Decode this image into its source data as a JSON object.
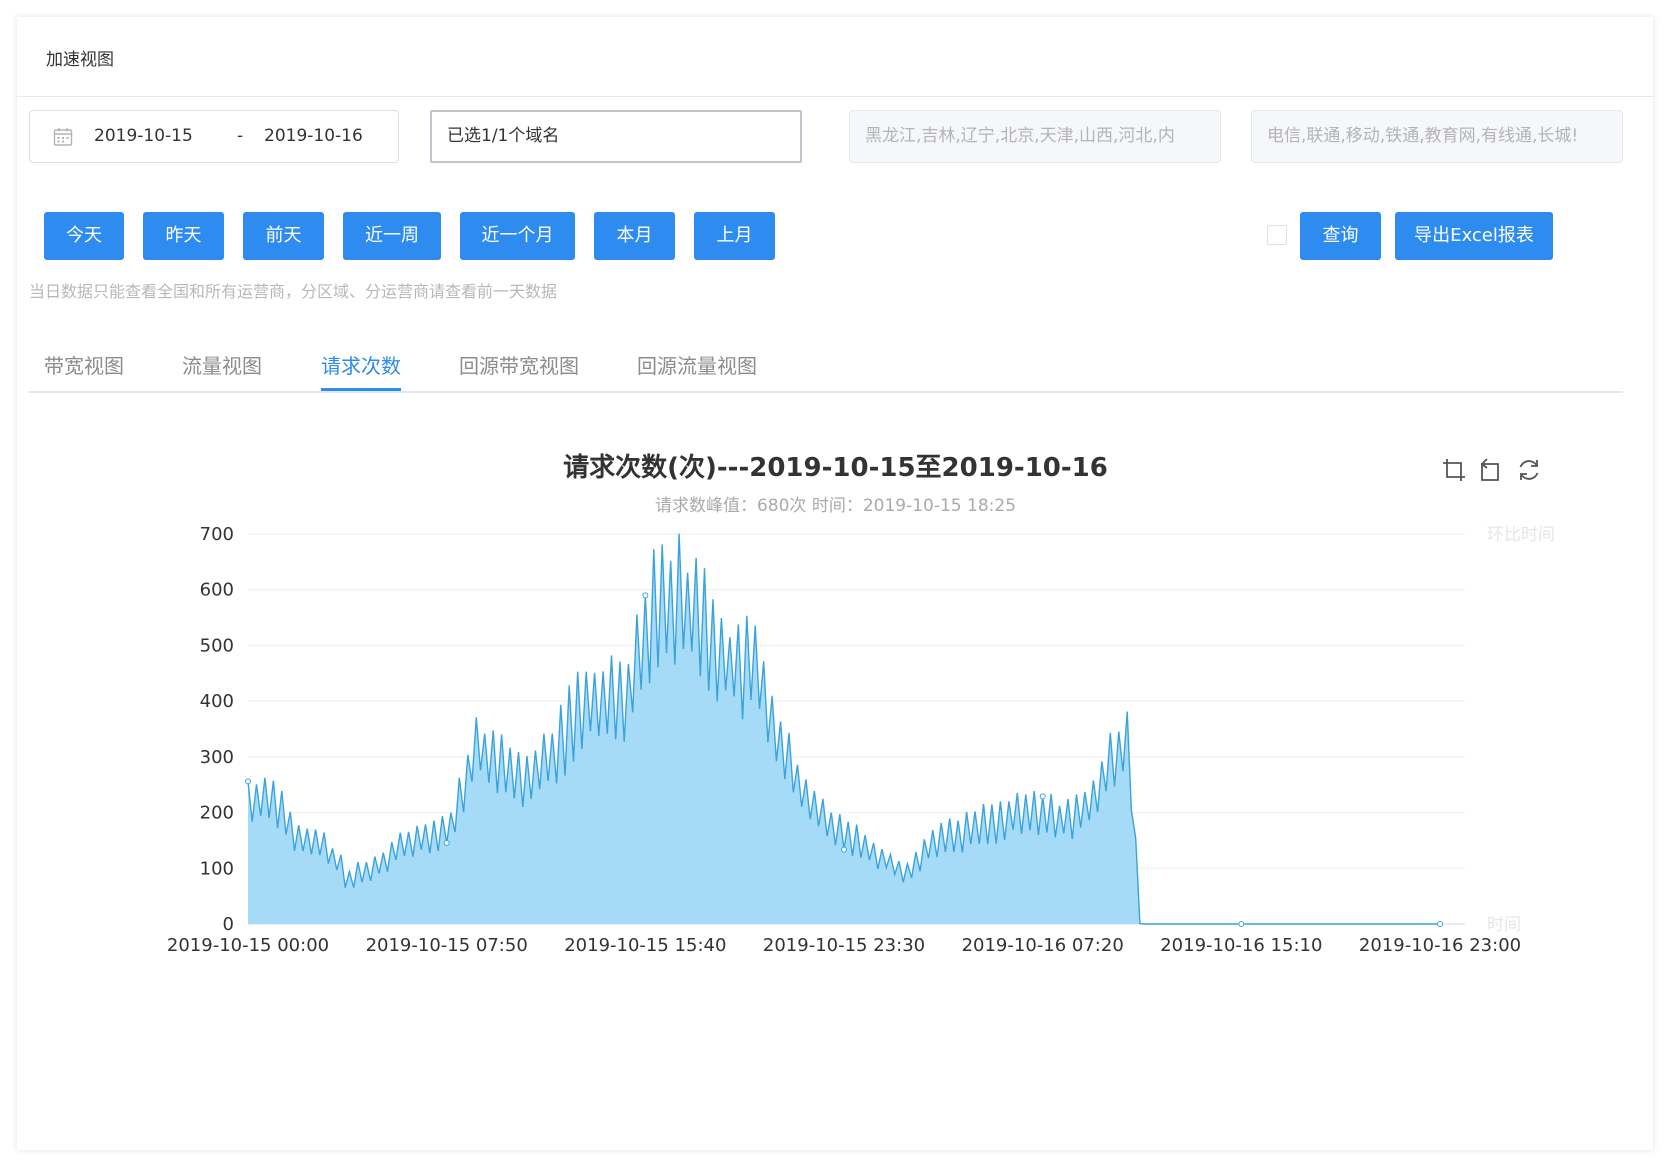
{
  "header": {
    "title": "加速视图"
  },
  "filters": {
    "start_date": "2019-10-15",
    "date_separator": "-",
    "end_date": "2019-10-16",
    "domain_value": "已选1/1个域名",
    "region_value": "黑龙江,吉林,辽宁,北京,天津,山西,河北,内",
    "isp_value": "电信,联通,移动,铁通,教育网,有线通,长城!"
  },
  "quick_buttons": [
    "今天",
    "昨天",
    "前天",
    "近一周",
    "近一个月",
    "本月",
    "上月"
  ],
  "compare_label": "环比",
  "query_label": "查询",
  "export_label": "导出Excel报表",
  "note": "当日数据只能查看全国和所有运营商，分区域、分运营商请查看前一天数据",
  "tabs": [
    {
      "label": "带宽视图",
      "active": false
    },
    {
      "label": "流量视图",
      "active": false
    },
    {
      "label": "请求次数",
      "active": true
    },
    {
      "label": "回源带宽视图",
      "active": false
    },
    {
      "label": "回源流量视图",
      "active": false
    }
  ],
  "colors": {
    "primary": "#2e8bef",
    "line": "#3aa3dc",
    "area": "#a6dbf7"
  },
  "chart_data": {
    "type": "area",
    "title": "请求次数(次)---2019-10-15至2019-10-16",
    "subtitle": "请求数峰值：680次 时间：2019-10-15 18:25",
    "ylim": [
      0,
      700
    ],
    "yticks": [
      0,
      100,
      200,
      300,
      400,
      500,
      600,
      700
    ],
    "xticks": [
      "2019-10-15 00:00",
      "2019-10-15 07:50",
      "2019-10-15 15:40",
      "2019-10-15 23:30",
      "2019-10-16 07:20",
      "2019-10-16 15:10",
      "2019-10-16 23:00"
    ],
    "right_axis_labels": {
      "top": "环比时间",
      "bottom": "时间"
    },
    "grid": true,
    "x_interval_minutes": 10,
    "series": [
      {
        "envelope_hours": [
          0,
          1,
          2,
          3,
          4,
          5,
          6,
          7,
          8,
          9,
          10,
          11,
          12,
          13,
          14,
          15,
          16,
          17,
          18,
          19,
          20,
          21,
          22,
          23,
          24,
          25,
          26,
          27,
          28,
          29,
          30,
          31,
          32,
          33,
          34.7,
          35.2,
          48
        ],
        "envelope_values": [
          220,
          230,
          150,
          140,
          80,
          100,
          140,
          160,
          170,
          320,
          280,
          260,
          300,
          380,
          400,
          420,
          580,
          580,
          540,
          460,
          460,
          320,
          220,
          180,
          150,
          120,
          90,
          150,
          160,
          180,
          190,
          200,
          190,
          200,
          340,
          0,
          0
        ]
      }
    ]
  }
}
